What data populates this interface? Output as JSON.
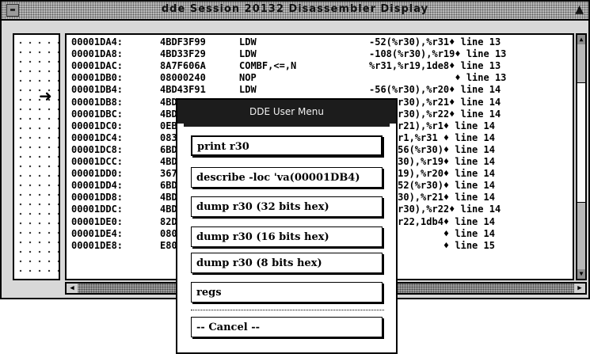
{
  "window": {
    "title": "dde Session 20132 Disassembler Display"
  },
  "disassembly": [
    {
      "addr": "00001DA4:",
      "hex": "4BDF3F99",
      "op": "LDW",
      "args": "-52(%r30),%r31♦ line 13"
    },
    {
      "addr": "00001DA8:",
      "hex": "4BD33F29",
      "op": "LDW",
      "args": "-108(%r30),%r19♦ line 13"
    },
    {
      "addr": "00001DAC:",
      "hex": "8A7F606A",
      "op": "COMBF,<=,N",
      "args": "%r31,%r19,1de8♦ line 13"
    },
    {
      "addr": "00001DB0:",
      "hex": "08000240",
      "op": "NOP",
      "args": "               ♦ line 13"
    },
    {
      "addr": "00001DB4:",
      "hex": "4BD43F91",
      "op": "LDW",
      "args": "-56(%r30),%r20♦ line 14"
    },
    {
      "addr": "00001DB8:",
      "hex": "4BD",
      "op": "",
      "args": "    %r30),%r21♦ line 14"
    },
    {
      "addr": "00001DBC:",
      "hex": "4BD",
      "op": "",
      "args": "    %r30),%r22♦ line 14"
    },
    {
      "addr": "00001DC0:",
      "hex": "0EB",
      "op": "",
      "args": "    %r21),%r1♦ line 14"
    },
    {
      "addr": "00001DC4:",
      "hex": "083",
      "op": "",
      "args": "    %r1,%r31 ♦ line 14"
    },
    {
      "addr": "00001DC8:",
      "hex": "6BD",
      "op": "",
      "args": "    -56(%r30)♦ line 14"
    },
    {
      "addr": "00001DCC:",
      "hex": "4BD",
      "op": "",
      "args": "    r30),%r19♦ line 14"
    },
    {
      "addr": "00001DD0:",
      "hex": "367",
      "op": "",
      "args": "    r19),%r20♦ line 14"
    },
    {
      "addr": "00001DD4:",
      "hex": "6BD",
      "op": "",
      "args": "    -52(%r30)♦ line 14"
    },
    {
      "addr": "00001DD8:",
      "hex": "4BD",
      "op": "",
      "args": "    r30),%r21♦ line 14"
    },
    {
      "addr": "00001DDC:",
      "hex": "4BD",
      "op": "",
      "args": "    %r30),%r22♦ line 14"
    },
    {
      "addr": "00001DE0:",
      "hex": "82D",
      "op": "",
      "args": "    %r22,1db4♦ line 14"
    },
    {
      "addr": "00001DE4:",
      "hex": "080",
      "op": "",
      "args": "             ♦ line 14"
    },
    {
      "addr": "00001DE8:",
      "hex": "E80",
      "op": "",
      "args": "             ♦ line 15"
    }
  ],
  "pc_marker": {
    "icon": "right-arrow-icon",
    "glyph": "➜"
  },
  "menu": {
    "title": "DDE User Menu",
    "items": [
      "print r30",
      "describe -loc 'va(00001DB4)",
      "dump r30 (32 bits hex)",
      "dump r30 (16 bits hex)",
      "dump r30 (8 bits hex)",
      "regs"
    ],
    "cancel": "-- Cancel --"
  }
}
